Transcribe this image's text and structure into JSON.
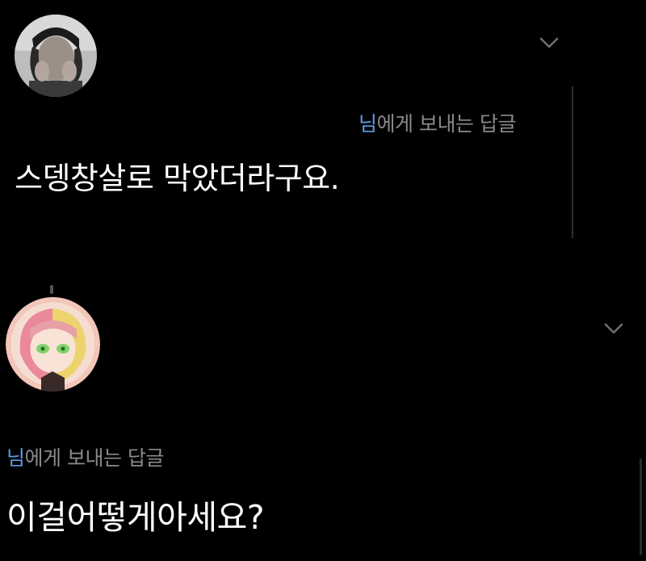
{
  "comments": [
    {
      "reply_user": "님",
      "reply_suffix": "에게 보내는 답글",
      "text": "스뎅창살로 막았더라구요.",
      "menu_icon": "chevron-down-icon",
      "avatar": "user-avatar"
    },
    {
      "reply_user": "님",
      "reply_suffix": "에게 보내는 답글",
      "text": "이걸어떻게아세요?",
      "menu_icon": "chevron-down-icon",
      "avatar": "user-avatar"
    }
  ],
  "colors": {
    "background": "#000000",
    "mention": "#5d9ce6",
    "secondary_text": "#8a8a8a",
    "primary_text": "#ffffff"
  }
}
